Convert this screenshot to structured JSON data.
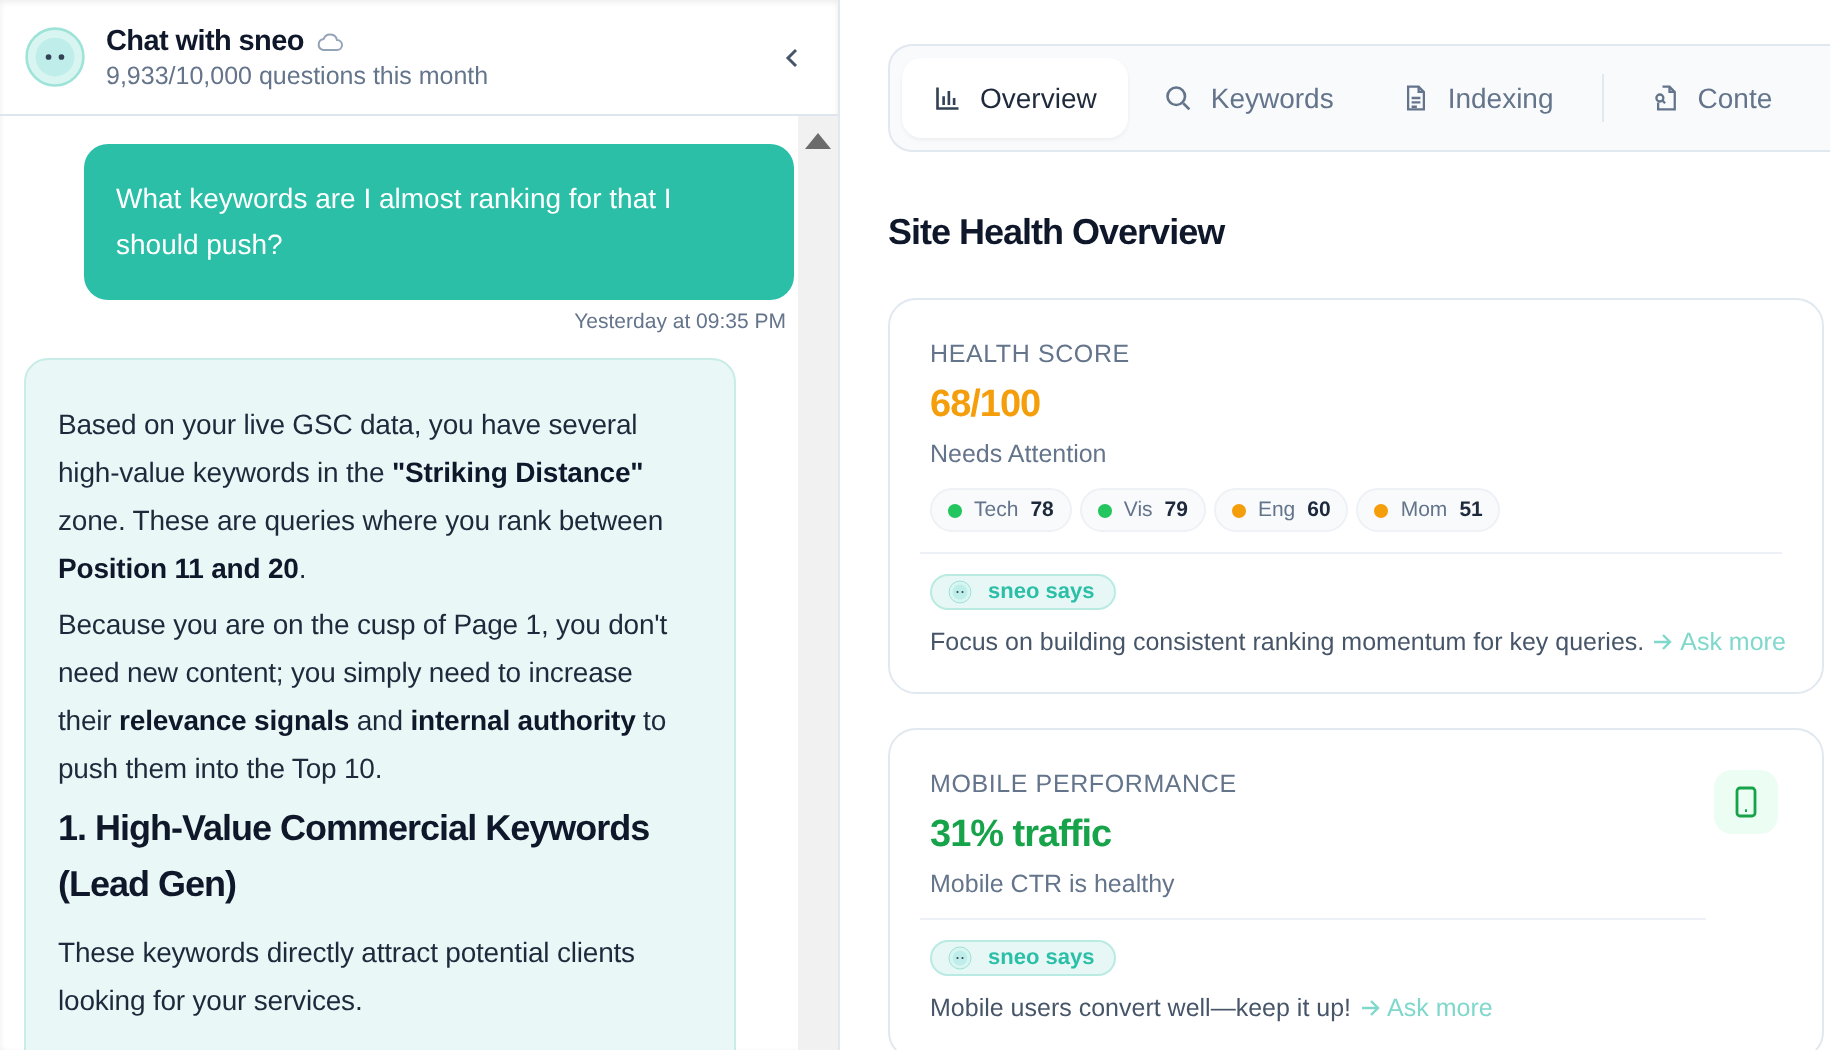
{
  "chat": {
    "title": "Chat with sneo",
    "subtitle": "9,933/10,000 questions this month",
    "messages": [
      {
        "kind": "user",
        "text": "What keywords are I almost ranking for that I should push?",
        "time": "Yesterday at 09:35 PM"
      },
      {
        "kind": "assistant",
        "blocks": [
          {
            "kind": "paragraph",
            "text": "Based on your live GSC data, you have several high-value keywords in the **\"Striking Distance\"** zone. These are queries where you rank between **Position 11 and 20**."
          },
          {
            "kind": "paragraph",
            "text": "Because you are on the cusp of Page 1, you don't need new content; you simply need to increase their **relevance signals** and **internal authority** to push them into the Top 10."
          },
          {
            "kind": "heading",
            "text": "1. High-Value Commercial Keywords (Lead Gen)"
          },
          {
            "kind": "paragraph",
            "text": "These keywords directly attract potential clients looking for your services."
          }
        ]
      }
    ]
  },
  "tabs": [
    {
      "label": "Overview",
      "selected": true
    },
    {
      "label": "Keywords",
      "selected": false
    },
    {
      "label": "Indexing",
      "selected": false
    },
    {
      "label": "Conte",
      "selected": false
    }
  ],
  "section_title": "Site Health Overview",
  "cards": [
    {
      "kind": "score",
      "label": "HEALTH SCORE",
      "value": "68/100",
      "color": "#f59e0b",
      "status": "Needs Attention",
      "pills": [
        {
          "label": "Tech",
          "value": "78",
          "color": "#22c55e"
        },
        {
          "label": "Vis",
          "value": "79",
          "color": "#22c55e"
        },
        {
          "label": "Eng",
          "value": "60",
          "color": "#f59e0b"
        },
        {
          "label": "Mom",
          "value": "51",
          "color": "#f59e0b"
        }
      ],
      "insight": {
        "badge": "sneo says",
        "text": "Focus on building consistent ranking momentum for key queries.",
        "link": "Ask more"
      }
    },
    {
      "kind": "mobile",
      "label": "MOBILE PERFORMANCE",
      "value": "31% traffic",
      "color": "#16a34a",
      "status": "Mobile CTR is healthy",
      "insight": {
        "badge": "sneo says",
        "text": "Mobile users convert well—keep it up!",
        "link": "Ask more"
      }
    }
  ]
}
